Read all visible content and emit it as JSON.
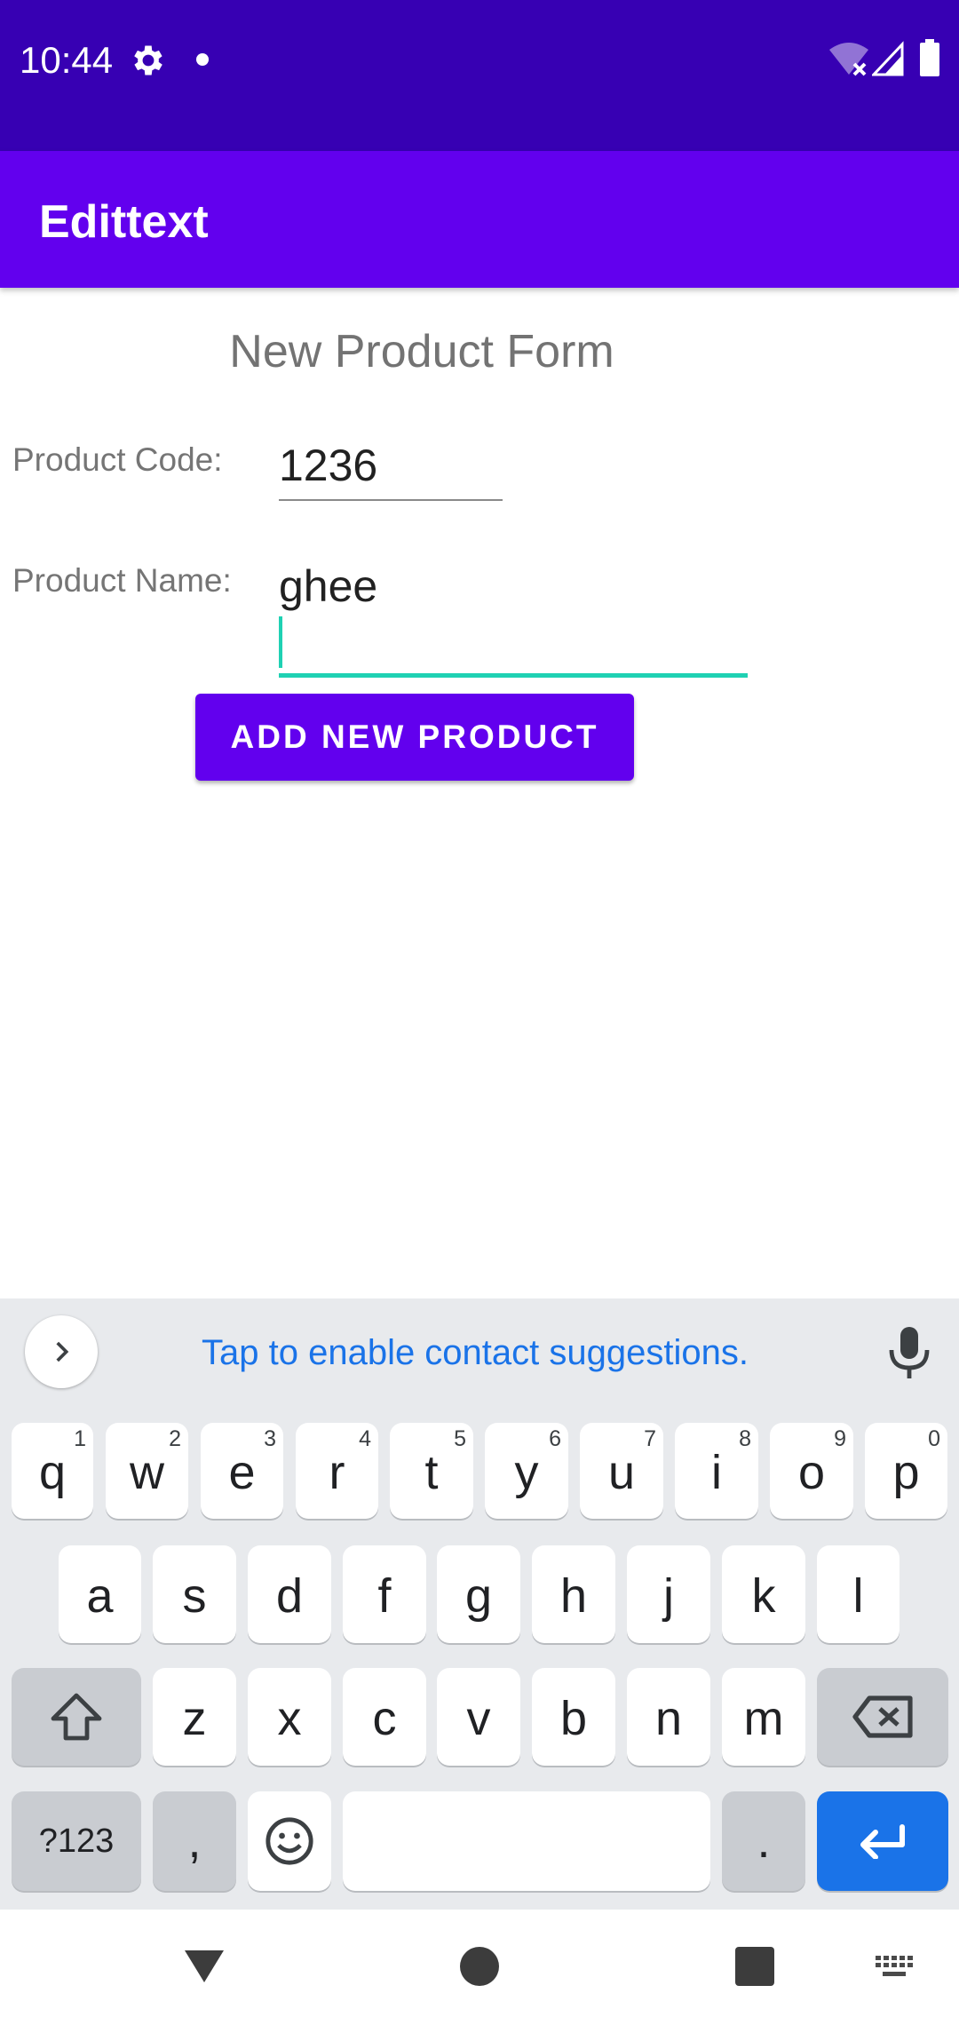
{
  "status_bar": {
    "time": "10:44"
  },
  "app_bar": {
    "title": "Edittext"
  },
  "form": {
    "heading": "New Product Form",
    "code_label": "Product Code:",
    "code_value": "1236",
    "name_label": "Product Name:",
    "name_value": "ghee",
    "add_button": "ADD NEW PRODUCT"
  },
  "keyboard": {
    "suggestion": "Tap to enable contact suggestions.",
    "row1": [
      {
        "label": "q",
        "hint": "1"
      },
      {
        "label": "w",
        "hint": "2"
      },
      {
        "label": "e",
        "hint": "3"
      },
      {
        "label": "r",
        "hint": "4"
      },
      {
        "label": "t",
        "hint": "5"
      },
      {
        "label": "y",
        "hint": "6"
      },
      {
        "label": "u",
        "hint": "7"
      },
      {
        "label": "i",
        "hint": "8"
      },
      {
        "label": "o",
        "hint": "9"
      },
      {
        "label": "p",
        "hint": "0"
      }
    ],
    "row2": [
      "a",
      "s",
      "d",
      "f",
      "g",
      "h",
      "j",
      "k",
      "l"
    ],
    "row3": [
      "z",
      "x",
      "c",
      "v",
      "b",
      "n",
      "m"
    ],
    "symbols_key": "?123",
    "comma_key": ",",
    "period_key": "."
  },
  "colors": {
    "status_bar": "#3700b3",
    "primary": "#6200ee",
    "focus_underline": "#1fd1b3",
    "keyboard_accent": "#1a73e8"
  }
}
